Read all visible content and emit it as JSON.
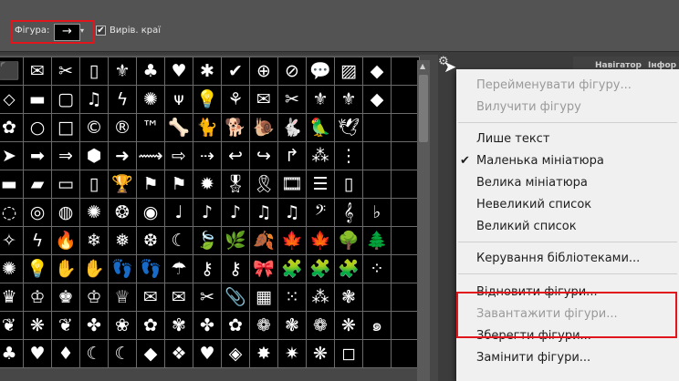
{
  "options_bar": {
    "shape_label": "Фігура:",
    "shape_preview": "→",
    "dropdown_arrow": "▾",
    "antialias_check": "✔",
    "antialias_label": "Вирів. краї"
  },
  "panel_tabs": [
    "Навігатор",
    "Інфор"
  ],
  "picker_shapes": [
    "⬛",
    "✉",
    "✂",
    "▯",
    "⚜",
    "♣",
    "♥",
    "✱",
    "✔",
    "⊕",
    "⊘",
    "💬",
    "▨",
    "◆",
    "",
    "⬦",
    "▬",
    "▢",
    "♫",
    "ϟ",
    "✺",
    "ᴪ",
    "💡",
    "⚘",
    "✉",
    "✂",
    "⚜",
    "⚜",
    "◆",
    "",
    "✿",
    "○",
    "□",
    "©",
    "®",
    "™",
    "🦴",
    "🐈",
    "🐕",
    "🐌",
    "🐇",
    "🦜",
    "🕊",
    "",
    "",
    "➤",
    "➡",
    "⇒",
    "⬢",
    "➜",
    "⟿",
    "⇨",
    "⇢",
    "↩",
    "↪",
    "↱",
    "⁂",
    "⋮",
    "",
    "",
    "▬",
    "▰",
    "▭",
    "▯",
    "🏆",
    "⚑",
    "⚑",
    "✹",
    "🎖",
    "🎗",
    "🎞",
    "☰",
    "▯",
    "",
    "",
    "◌",
    "◎",
    "◍",
    "✺",
    "❂",
    "◉",
    "♩",
    "♪",
    "♪",
    "♫",
    "♫",
    "𝄢",
    "𝄞",
    "♭",
    "",
    "✧",
    "ϟ",
    "🔥",
    "❄",
    "❅",
    "❆",
    "☾",
    "🍃",
    "🌿",
    "🍂",
    "🍁",
    "🍁",
    "🌳",
    "🌲",
    "",
    "✺",
    "💡",
    "✋",
    "✋",
    "👣",
    "👣",
    "☂",
    "⚷",
    "⚷",
    "🎀",
    "🧩",
    "🧩",
    "🧩",
    "⁘",
    "",
    "♛",
    "♔",
    "♚",
    "♔",
    "♕",
    "✉",
    "✉",
    "✂",
    "📎",
    "▦",
    "⁙",
    "⁂",
    "❃",
    "",
    "",
    "❦",
    "❋",
    "❦",
    "✤",
    "❀",
    "✿",
    "✾",
    "✤",
    "✿",
    "❁",
    "❃",
    "❁",
    "❋",
    "๑",
    "",
    "♣",
    "♥",
    "♦",
    "☾",
    "☾",
    "◆",
    "❖",
    "♥",
    "◈",
    "✸",
    "✷",
    "❋",
    "◻",
    "",
    ""
  ],
  "menu": {
    "highlight_note": "",
    "items": [
      {
        "label": "Перейменувати фігуру...",
        "disabled": true
      },
      {
        "label": "Вилучити фігуру",
        "disabled": true
      },
      {
        "label": "Лише текст",
        "disabled": false
      },
      {
        "label": "Маленька мініатюра",
        "disabled": false,
        "checked": true,
        "check_mark": "✔"
      },
      {
        "label": "Велика мініатюра",
        "disabled": false
      },
      {
        "label": "Невеликий список",
        "disabled": false
      },
      {
        "label": "Великий список",
        "disabled": false
      },
      {
        "label": "Керування бібліотеками...",
        "disabled": false
      },
      {
        "label": "Відновити фігури...",
        "disabled": false
      },
      {
        "label": "Завантажити фігури...",
        "disabled": true
      },
      {
        "label": "Зберегти фігури...",
        "disabled": false
      },
      {
        "label": "Замінити фігури...",
        "disabled": false
      }
    ]
  },
  "icons": {
    "gear": "gear-icon",
    "scroll_up": "▲",
    "cursor": "➤"
  },
  "colors": {
    "highlight": "#e0161c",
    "menu_bg": "#f0f0f0",
    "toolbar_bg": "#535353"
  }
}
